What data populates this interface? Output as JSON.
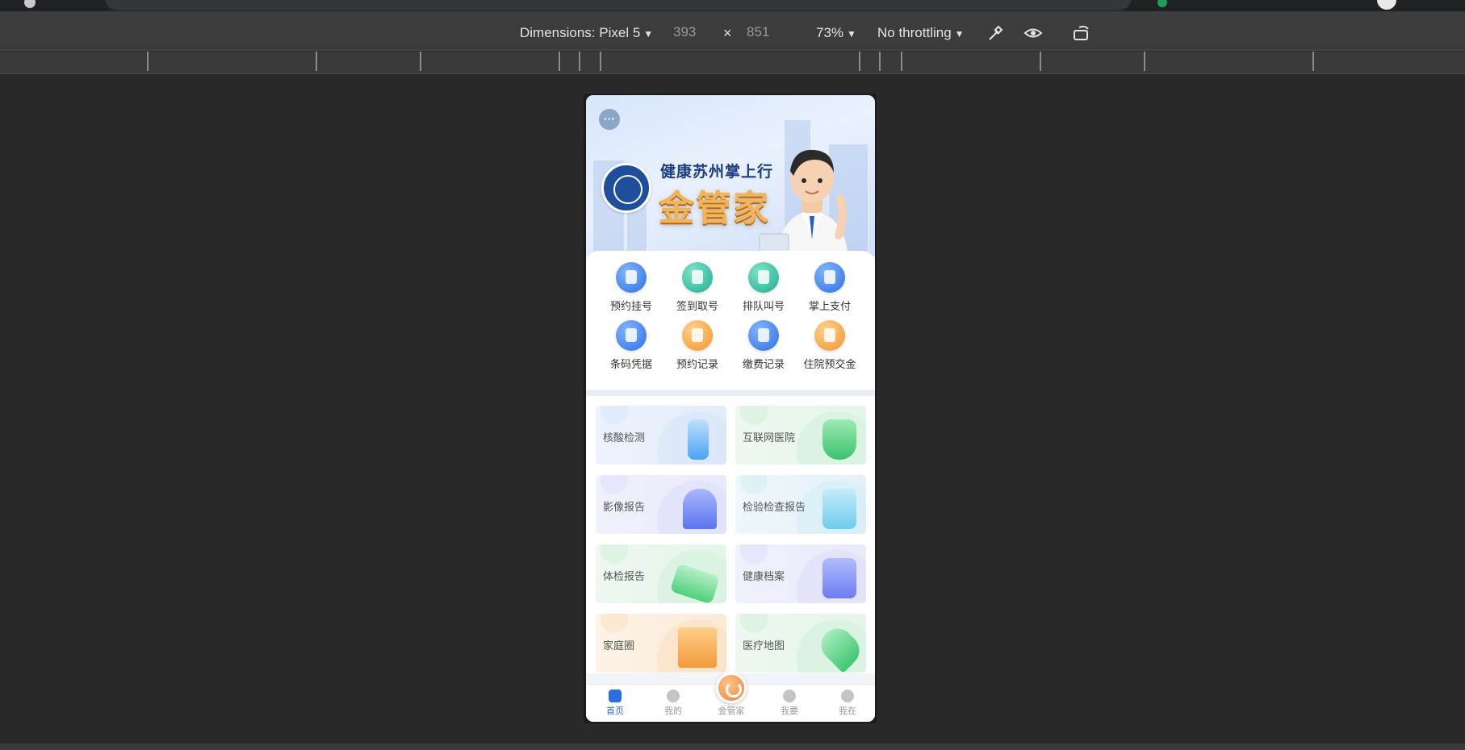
{
  "device_toolbar": {
    "dimensions_label": "Dimensions: Pixel 5",
    "width": "393",
    "times": "×",
    "height": "851",
    "zoom": "73%",
    "throttling": "No throttling"
  },
  "app": {
    "banner": {
      "subtitle": "健康苏州掌上行",
      "title": "金管家"
    },
    "functions": [
      {
        "label": "预约挂号",
        "icon": "register-icon",
        "color": "blue"
      },
      {
        "label": "签到取号",
        "icon": "checkin-icon",
        "color": "teal"
      },
      {
        "label": "排队叫号",
        "icon": "queue-icon",
        "color": "teal"
      },
      {
        "label": "掌上支付",
        "icon": "mobile-pay-icon",
        "color": "blue"
      },
      {
        "label": "条码凭据",
        "icon": "barcode-icon",
        "color": "blue"
      },
      {
        "label": "预约记录",
        "icon": "appointment-record-icon",
        "color": "orange"
      },
      {
        "label": "缴费记录",
        "icon": "payment-record-icon",
        "color": "blue"
      },
      {
        "label": "住院预交金",
        "icon": "inpatient-deposit-icon",
        "color": "orange"
      }
    ],
    "services": [
      {
        "label": "核酸检测",
        "icon": "test-tube-icon",
        "theme": "blue"
      },
      {
        "label": "互联网医院",
        "icon": "shield-cross-icon",
        "theme": "green"
      },
      {
        "label": "影像报告",
        "icon": "scanner-icon",
        "theme": "purple"
      },
      {
        "label": "检验检查报告",
        "icon": "scroll-icon",
        "theme": "cyan"
      },
      {
        "label": "体检报告",
        "icon": "checkup-report-icon",
        "theme": "green"
      },
      {
        "label": "健康档案",
        "icon": "file-box-icon",
        "theme": "purple"
      },
      {
        "label": "家庭圈",
        "icon": "house-icon",
        "theme": "orange"
      },
      {
        "label": "医疗地图",
        "icon": "map-pin-icon",
        "theme": "green"
      }
    ],
    "tabbar": [
      {
        "label": "首页",
        "icon": "home-icon",
        "active": true
      },
      {
        "label": "我的",
        "icon": "profile-icon",
        "active": false
      },
      {
        "label": "金管家",
        "icon": "butler-icon",
        "active": false
      },
      {
        "label": "我要",
        "icon": "request-icon",
        "active": false
      },
      {
        "label": "我在",
        "icon": "location-icon",
        "active": false
      }
    ]
  },
  "colors": {
    "accent": "#2a6ee0",
    "banner_title": "#f2b35b",
    "page_bg": "#292929"
  }
}
